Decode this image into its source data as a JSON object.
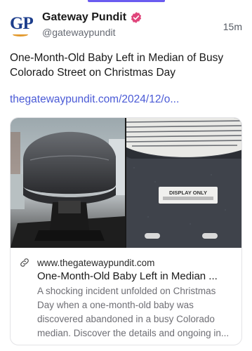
{
  "post": {
    "display_name": "Gateway Pundit",
    "handle": "@gatewaypundit",
    "timestamp": "15m",
    "avatar_text": "GP",
    "text": "One-Month-Old Baby Left in Median of Busy Colorado Street on Christmas Day",
    "link": "thegatewaypundit.com/2024/12/o..."
  },
  "card": {
    "domain": "www.thegatewaypundit.com",
    "title": "One-Month-Old Baby Left in Median ...",
    "description": "A shocking incident unfolded on Christmas Day when a one-month-old baby was discovered abandoned in a busy Colorado median. Discover the details and ongoing in...",
    "tag_text": "DISPLAY ONLY"
  },
  "colors": {
    "accent": "#6a5cf0",
    "link": "#4a5ad6",
    "verified_badge": "#e0457b",
    "avatar_brand": "#1d3e8c"
  },
  "icons": [
    "verified-badge-icon",
    "link-icon"
  ]
}
